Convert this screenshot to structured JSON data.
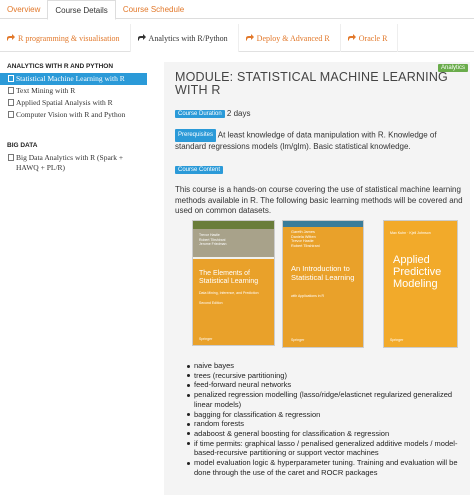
{
  "top_tabs": [
    "Overview",
    "Course Details",
    "Course Schedule"
  ],
  "sub_tabs": [
    "R programming & visualisation",
    "Analytics with R/Python",
    "Deploy & Advanced R",
    "Oracle R"
  ],
  "sidebar": {
    "group1": "ANALYTICS WITH R AND PYTHON",
    "items1": [
      "Statistical Machine Learning with R",
      "Text Mining with R",
      "Applied Spatial Analysis with R",
      "Computer Vision with R and Python"
    ],
    "group2": "BIG DATA",
    "items2": [
      "Big Data Analytics with R (Spark + HAWQ + PL/R)"
    ]
  },
  "panel": {
    "badge": "Analytics",
    "title": "MODULE: STATISTICAL MACHINE LEARNING WITH R",
    "duration_label": "Course Duration",
    "duration_value": "2 days",
    "prereq_label": "Prerequisites",
    "prereq_text": "At least knowledge of data manipulation with R. Knowledge of standard regressions models (lm/glm). Basic statistical knowledge.",
    "content_label": "Course Content",
    "intro": "This course is a hands-on course covering the use of statistical machine learning methods available in R. The following basic learning methods will be covered and used on common datasets."
  },
  "books": [
    {
      "authors": [
        "Trevor Hastie",
        "Robert Tibshirani",
        "Jerome Friedman"
      ],
      "title": "The Elements of Statistical Learning",
      "subtitle": "Data Mining, Inference, and Prediction",
      "edition": "Second Edition",
      "publisher": "Springer"
    },
    {
      "authors": [
        "Gareth James",
        "Daniela Witten",
        "Trevor Hastie",
        "Robert Tibshirani"
      ],
      "title": "An Introduction to Statistical Learning",
      "subtitle": "with Applications in R",
      "publisher": "Springer"
    },
    {
      "authors": [
        "Max Kuhn · Kjell Johnson"
      ],
      "title": "Applied Predictive Modeling",
      "publisher": "Springer"
    }
  ],
  "bullets": [
    "naive bayes",
    "trees (recursive partitioning)",
    "feed-forward neural networks",
    "penalized regression modelling (lasso/ridge/elasticnet regularized generalized linear models)",
    "bagging for classification & regression",
    "random forests",
    "adaboost & general boosting for classification & regression",
    "if time permits: graphical lasso / penalised generalized additive models / model-based-recursive partitioning or support vector machines",
    "model evaluation logic & hyperparameter tuning. Training and evaluation will be done through the use of the caret and ROCR packages"
  ],
  "colors": {
    "accent_orange": "#e2782a",
    "active_blue": "#2b9ad8",
    "badge_green": "#6aac4b"
  }
}
